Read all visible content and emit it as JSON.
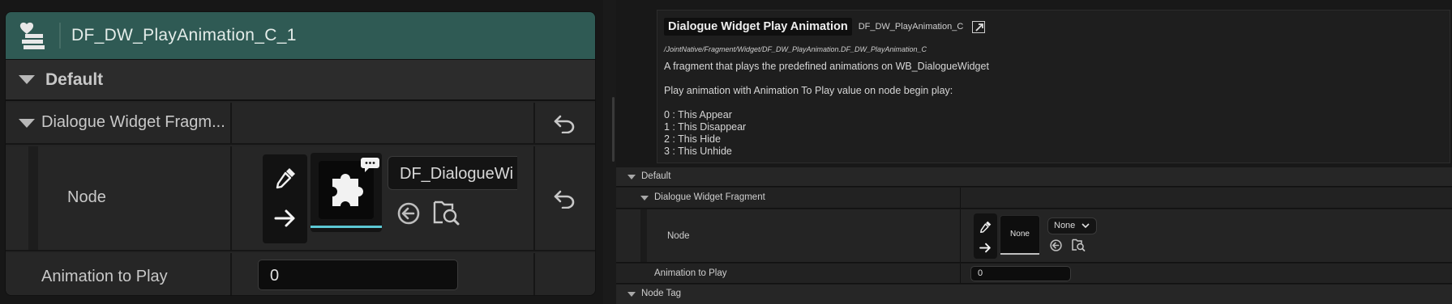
{
  "left_panel": {
    "node_title": "DF_DW_PlayAnimation_C_1",
    "category_default": "Default",
    "dialogue_widget_fragment_label": "Dialogue Widget Fragm...",
    "node_label": "Node",
    "node_combo_value": "DF_DialogueWi",
    "animation_to_play_label": "Animation to Play",
    "animation_to_play_value": "0",
    "title_bar_color": "#2f5a54",
    "accent_color": "#5cc8d4"
  },
  "right_panel": {
    "tooltip": {
      "title": "Dialogue Widget Play Animation",
      "class_name": "DF_DW_PlayAnimation_C",
      "path": "/JointNative/Fragment/Widget/DF_DW_PlayAnimation.DF_DW_PlayAnimation_C",
      "description": "A fragment that plays the predefined animations on WB_DialogueWidget",
      "play_note": "Play animation with Animation To Play value on node begin play:",
      "options": [
        "0 : This Appear",
        "1 : This Disappear",
        "2 : This Hide",
        "3 : This Unhide"
      ]
    },
    "category_default": "Default",
    "dialogue_widget_fragment_label": "Dialogue Widget Fragment",
    "node_label": "Node",
    "node_thumb_text": "None",
    "node_combo_value": "None",
    "animation_to_play_label": "Animation to Play",
    "animation_to_play_value": "0",
    "category_node_tag": "Node Tag"
  }
}
